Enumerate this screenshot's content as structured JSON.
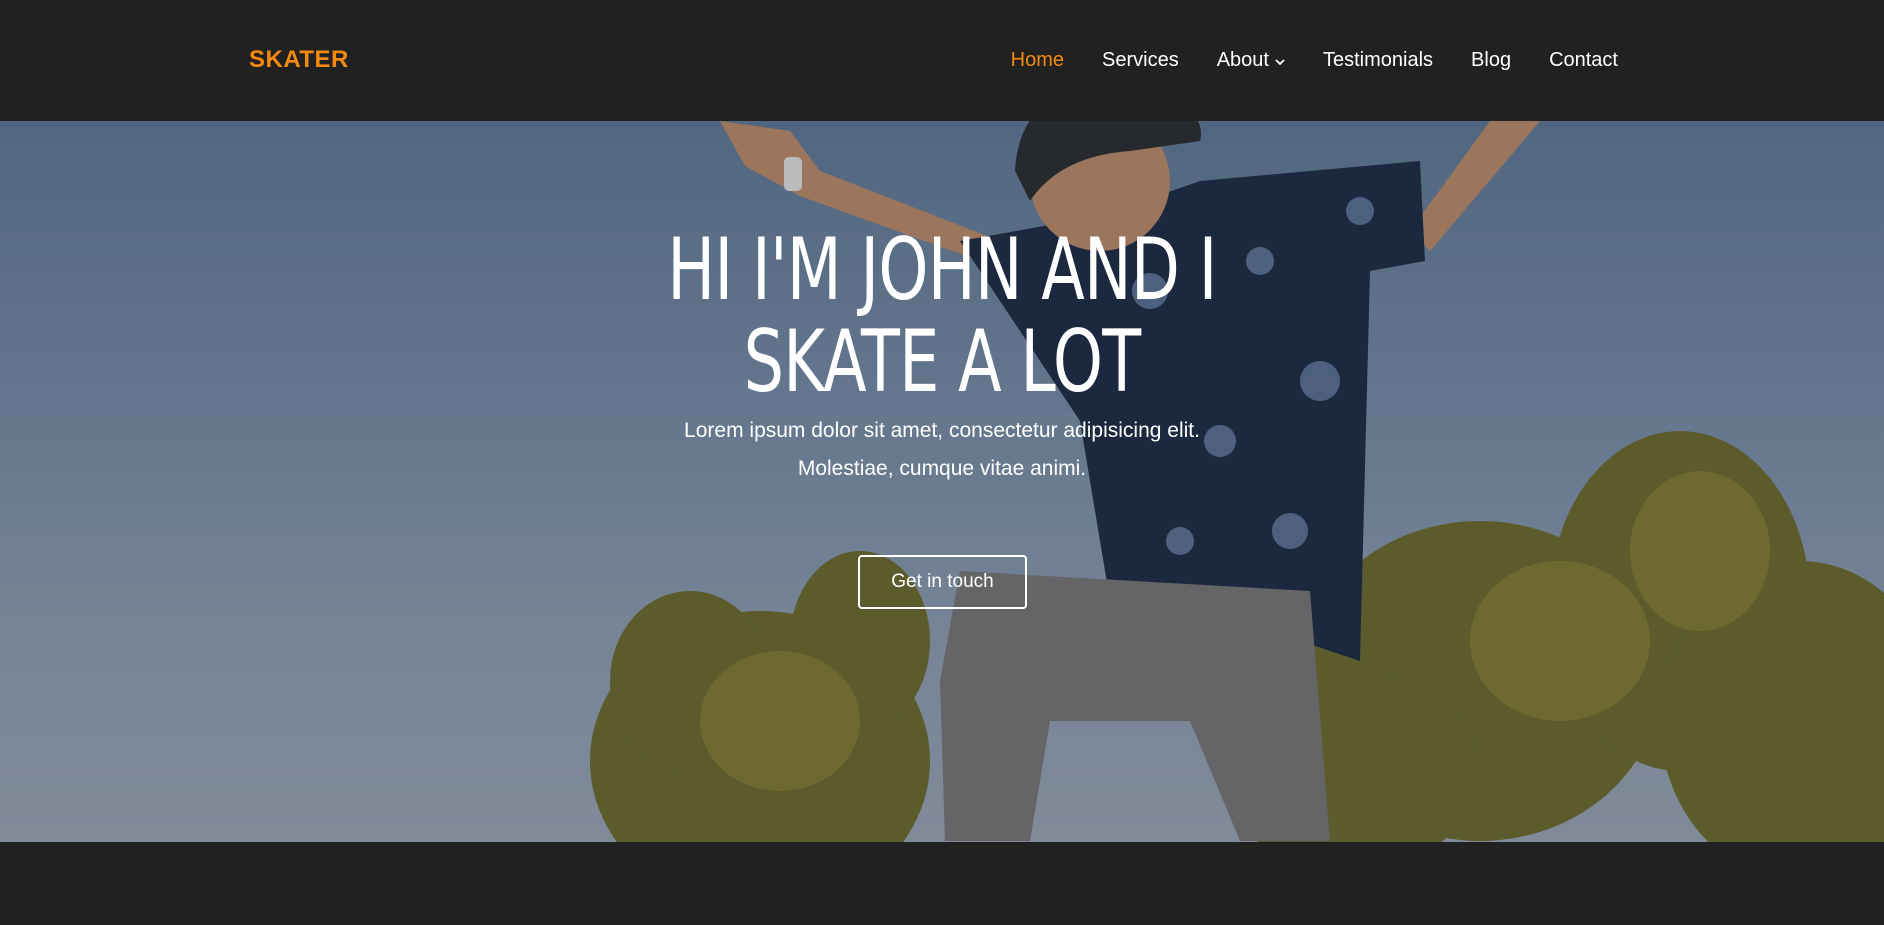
{
  "brand": {
    "logo": "SKATER",
    "accent_color": "#f3890f"
  },
  "nav": {
    "items": [
      {
        "label": "Home",
        "active": true
      },
      {
        "label": "Services",
        "active": false
      },
      {
        "label": "About",
        "active": false,
        "has_dropdown": true,
        "icon": "chevron-down-icon"
      },
      {
        "label": "Testimonials",
        "active": false
      },
      {
        "label": "Blog",
        "active": false
      },
      {
        "label": "Contact",
        "active": false
      }
    ]
  },
  "hero": {
    "title_lines": [
      "HI I'M JOHN AND I",
      "SKATE A LOT"
    ],
    "subtitle_lines": [
      "Lorem ipsum dolor sit amet, consectetur adipisicing elit.",
      "Molestiae, cumque vitae animi."
    ],
    "cta_label": "Get in touch",
    "background": "photo of a skater jumping against blue sky with trees"
  }
}
